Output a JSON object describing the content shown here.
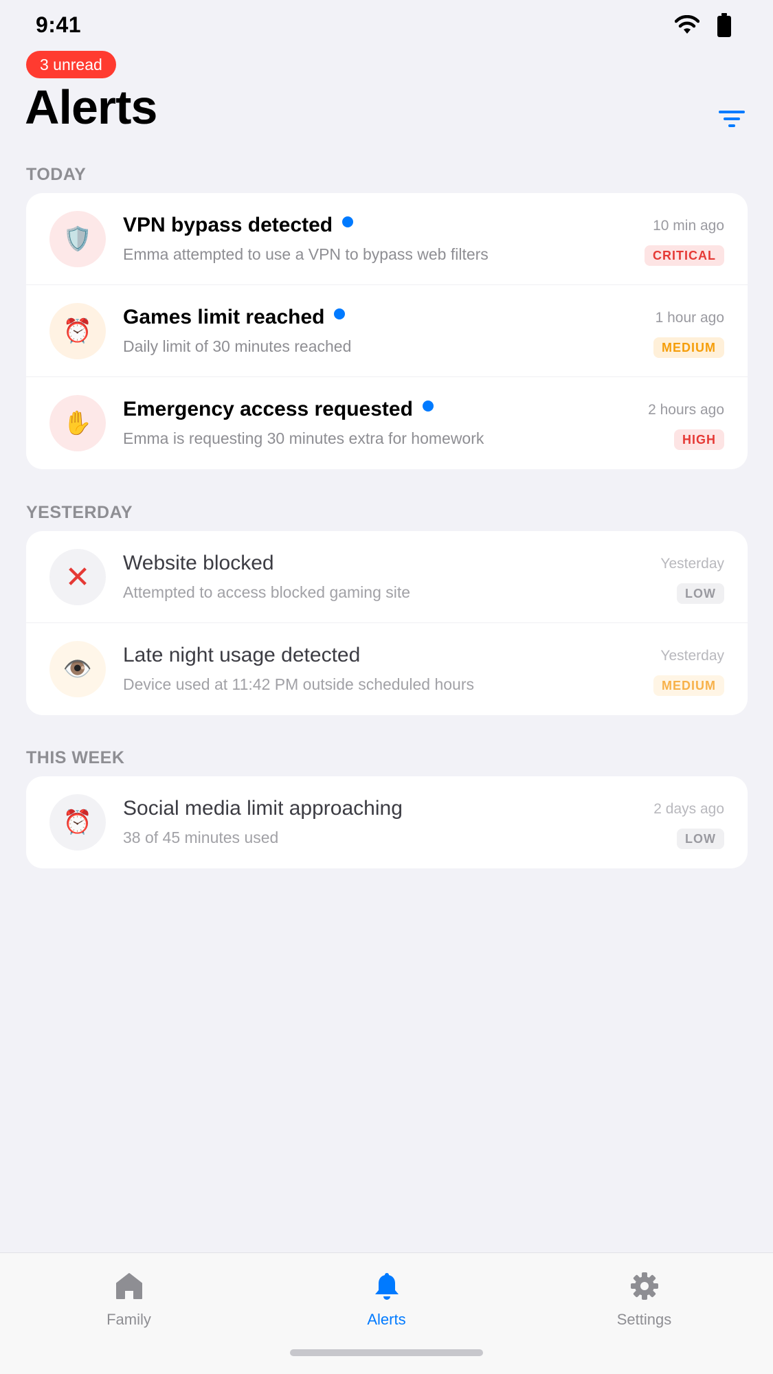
{
  "status_bar": {
    "time": "9:41"
  },
  "header": {
    "unread_badge": "3 unread",
    "title": "Alerts"
  },
  "sections": [
    {
      "label": "TODAY",
      "items": [
        {
          "title": "VPN bypass detected",
          "subtitle": "Emma attempted to use a VPN to bypass web filters",
          "time": "10 min ago",
          "severity": "CRITICAL",
          "unread": true,
          "icon": "shield-icon",
          "icon_glyph": "🛡️"
        },
        {
          "title": "Games limit reached",
          "subtitle": "Daily limit of 30 minutes reached",
          "time": "1 hour ago",
          "severity": "MEDIUM",
          "unread": true,
          "icon": "alarm-clock-icon",
          "icon_glyph": "⏰"
        },
        {
          "title": "Emergency access requested",
          "subtitle": "Emma is requesting 30 minutes extra for homework",
          "time": "2 hours ago",
          "severity": "HIGH",
          "unread": true,
          "icon": "raised-hand-icon",
          "icon_glyph": "✋"
        }
      ]
    },
    {
      "label": "YESTERDAY",
      "items": [
        {
          "title": "Website blocked",
          "subtitle": "Attempted to access blocked gaming site",
          "time": "Yesterday",
          "severity": "LOW",
          "unread": false,
          "icon": "cross-mark-icon",
          "icon_glyph": "✕"
        },
        {
          "title": "Late night usage detected",
          "subtitle": "Device used at 11:42 PM outside scheduled hours",
          "time": "Yesterday",
          "severity": "MEDIUM",
          "unread": false,
          "icon": "eye-icon",
          "icon_glyph": "👁️"
        }
      ]
    },
    {
      "label": "THIS WEEK",
      "items": [
        {
          "title": "Social media limit approaching",
          "subtitle": "38 of 45 minutes used",
          "time": "2 days ago",
          "severity": "LOW",
          "unread": false,
          "icon": "alarm-clock-icon",
          "icon_glyph": "⏰"
        }
      ]
    }
  ],
  "tabs": [
    {
      "label": "Family",
      "icon": "house-icon",
      "active": false
    },
    {
      "label": "Alerts",
      "icon": "bell-icon",
      "active": true
    },
    {
      "label": "Settings",
      "icon": "gear-icon",
      "active": false
    }
  ],
  "colors": {
    "accent": "#007AFF",
    "badge": "#FF3B30",
    "background": "#F2F2F7"
  }
}
